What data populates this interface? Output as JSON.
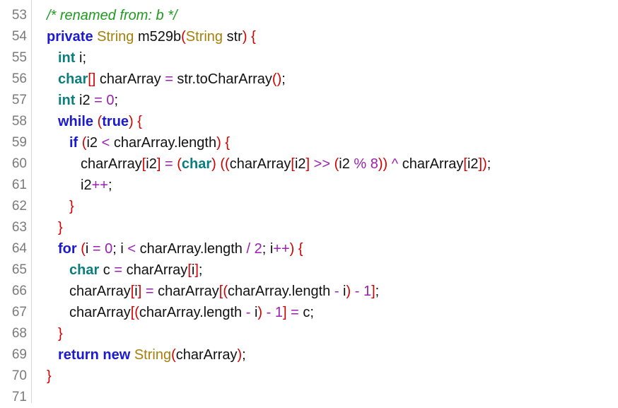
{
  "editor": {
    "line_numbers": [
      "53",
      "54",
      "55",
      "56",
      "57",
      "58",
      "59",
      "60",
      "61",
      "62",
      "63",
      "64",
      "65",
      "66",
      "67",
      "68",
      "69",
      "70",
      "71"
    ],
    "lines": [
      [
        {
          "t": "/* renamed from: b */",
          "c": "comment"
        }
      ],
      [
        {
          "t": "private",
          "c": "kw-blue"
        },
        {
          "t": " "
        },
        {
          "t": "String",
          "c": "type"
        },
        {
          "t": " m529b"
        },
        {
          "t": "(",
          "c": "red"
        },
        {
          "t": "String",
          "c": "type"
        },
        {
          "t": " str"
        },
        {
          "t": ")",
          "c": "red"
        },
        {
          "t": " "
        },
        {
          "t": "{",
          "c": "red"
        }
      ],
      [
        {
          "t": "int",
          "c": "kw-teal"
        },
        {
          "t": " i;"
        }
      ],
      [
        {
          "t": "char",
          "c": "kw-teal"
        },
        {
          "t": "[]",
          "c": "red"
        },
        {
          "t": " charArray "
        },
        {
          "t": "=",
          "c": "op"
        },
        {
          "t": " str.toCharArray"
        },
        {
          "t": "()",
          "c": "red"
        },
        {
          "t": ";"
        }
      ],
      [
        {
          "t": "int",
          "c": "kw-teal"
        },
        {
          "t": " i2 "
        },
        {
          "t": "=",
          "c": "op"
        },
        {
          "t": " "
        },
        {
          "t": "0",
          "c": "num"
        },
        {
          "t": ";"
        }
      ],
      [
        {
          "t": "while",
          "c": "kw-blue"
        },
        {
          "t": " "
        },
        {
          "t": "(",
          "c": "red"
        },
        {
          "t": "true",
          "c": "kw-blue"
        },
        {
          "t": ")",
          "c": "red"
        },
        {
          "t": " "
        },
        {
          "t": "{",
          "c": "red"
        }
      ],
      [
        {
          "t": "if",
          "c": "kw-blue"
        },
        {
          "t": " "
        },
        {
          "t": "(",
          "c": "red"
        },
        {
          "t": "i2 "
        },
        {
          "t": "<",
          "c": "op"
        },
        {
          "t": " charArray.length"
        },
        {
          "t": ")",
          "c": "red"
        },
        {
          "t": " "
        },
        {
          "t": "{",
          "c": "red"
        }
      ],
      [
        {
          "t": "charArray"
        },
        {
          "t": "[",
          "c": "red"
        },
        {
          "t": "i2"
        },
        {
          "t": "]",
          "c": "red"
        },
        {
          "t": " "
        },
        {
          "t": "=",
          "c": "op"
        },
        {
          "t": " "
        },
        {
          "t": "(",
          "c": "red"
        },
        {
          "t": "char",
          "c": "kw-teal"
        },
        {
          "t": ")",
          "c": "red"
        },
        {
          "t": " "
        },
        {
          "t": "((",
          "c": "red"
        },
        {
          "t": "charArray"
        },
        {
          "t": "[",
          "c": "red"
        },
        {
          "t": "i2"
        },
        {
          "t": "]",
          "c": "red"
        },
        {
          "t": " "
        },
        {
          "t": ">>",
          "c": "op"
        },
        {
          "t": " "
        },
        {
          "t": "(",
          "c": "red"
        },
        {
          "t": "i2 "
        },
        {
          "t": "%",
          "c": "op"
        },
        {
          "t": " "
        },
        {
          "t": "8",
          "c": "num"
        },
        {
          "t": "))",
          "c": "red"
        },
        {
          "t": " "
        },
        {
          "t": "^",
          "c": "op"
        },
        {
          "t": " charArray"
        },
        {
          "t": "[",
          "c": "red"
        },
        {
          "t": "i2"
        },
        {
          "t": "])",
          "c": "red"
        },
        {
          "t": ";"
        }
      ],
      [
        {
          "t": "i2"
        },
        {
          "t": "++",
          "c": "op"
        },
        {
          "t": ";"
        }
      ],
      [
        {
          "t": "}",
          "c": "red"
        }
      ],
      [
        {
          "t": "}",
          "c": "red"
        }
      ],
      [
        {
          "t": "for",
          "c": "kw-blue"
        },
        {
          "t": " "
        },
        {
          "t": "(",
          "c": "red"
        },
        {
          "t": "i "
        },
        {
          "t": "=",
          "c": "op"
        },
        {
          "t": " "
        },
        {
          "t": "0",
          "c": "num"
        },
        {
          "t": "; i "
        },
        {
          "t": "<",
          "c": "op"
        },
        {
          "t": " charArray.length "
        },
        {
          "t": "/",
          "c": "op"
        },
        {
          "t": " "
        },
        {
          "t": "2",
          "c": "num"
        },
        {
          "t": "; i"
        },
        {
          "t": "++",
          "c": "op"
        },
        {
          "t": ")",
          "c": "red"
        },
        {
          "t": " "
        },
        {
          "t": "{",
          "c": "red"
        }
      ],
      [
        {
          "t": "char",
          "c": "kw-teal"
        },
        {
          "t": " c "
        },
        {
          "t": "=",
          "c": "op"
        },
        {
          "t": " charArray"
        },
        {
          "t": "[",
          "c": "red"
        },
        {
          "t": "i"
        },
        {
          "t": "]",
          "c": "red"
        },
        {
          "t": ";"
        }
      ],
      [
        {
          "t": "charArray"
        },
        {
          "t": "[",
          "c": "red"
        },
        {
          "t": "i"
        },
        {
          "t": "]",
          "c": "red"
        },
        {
          "t": " "
        },
        {
          "t": "=",
          "c": "op"
        },
        {
          "t": " charArray"
        },
        {
          "t": "[(",
          "c": "red"
        },
        {
          "t": "charArray.length "
        },
        {
          "t": "-",
          "c": "op"
        },
        {
          "t": " i"
        },
        {
          "t": ")",
          "c": "red"
        },
        {
          "t": " "
        },
        {
          "t": "-",
          "c": "op"
        },
        {
          "t": " "
        },
        {
          "t": "1",
          "c": "num"
        },
        {
          "t": "]",
          "c": "red"
        },
        {
          "t": ";"
        }
      ],
      [
        {
          "t": "charArray"
        },
        {
          "t": "[(",
          "c": "red"
        },
        {
          "t": "charArray.length "
        },
        {
          "t": "-",
          "c": "op"
        },
        {
          "t": " i"
        },
        {
          "t": ")",
          "c": "red"
        },
        {
          "t": " "
        },
        {
          "t": "-",
          "c": "op"
        },
        {
          "t": " "
        },
        {
          "t": "1",
          "c": "num"
        },
        {
          "t": "]",
          "c": "red"
        },
        {
          "t": " "
        },
        {
          "t": "=",
          "c": "op"
        },
        {
          "t": " c;"
        }
      ],
      [
        {
          "t": "}",
          "c": "red"
        }
      ],
      [
        {
          "t": "return",
          "c": "kw-blue"
        },
        {
          "t": " "
        },
        {
          "t": "new",
          "c": "kw-blue"
        },
        {
          "t": " "
        },
        {
          "t": "String",
          "c": "type"
        },
        {
          "t": "(",
          "c": "red"
        },
        {
          "t": "charArray"
        },
        {
          "t": ")",
          "c": "red"
        },
        {
          "t": ";"
        }
      ],
      [
        {
          "t": "}",
          "c": "red"
        }
      ],
      []
    ],
    "colors": {
      "keyword": "#1a1ad2",
      "primitive": "#0a7d7d",
      "type": "#a67f0a",
      "comment": "#1f9b1f",
      "bracket": "#d00000",
      "number": "#9a1fb0",
      "line_number": "#7a7a7a"
    }
  }
}
